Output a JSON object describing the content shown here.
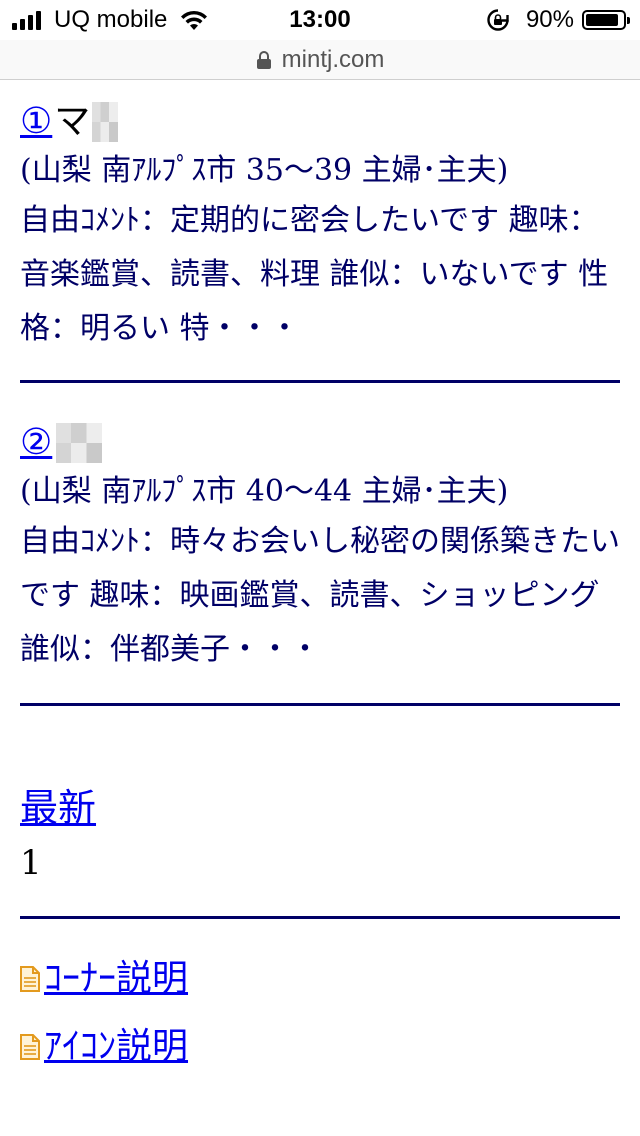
{
  "status_bar": {
    "carrier": "UQ mobile",
    "time": "13:00",
    "battery_percent": "90%",
    "battery_level": 0.9
  },
  "url_bar": {
    "domain": "mintj.com"
  },
  "posts": [
    {
      "number": "①",
      "name": "マ",
      "meta": "(山梨 南ｱﾙﾌﾟｽ市 35〜39 主婦･主夫)",
      "body": "自由ｺﾒﾝﾄ：定期的に密会したいです 趣味：音楽鑑賞、読書、料理 誰似：いないです 性格：明るい 特・・・"
    },
    {
      "number": "②",
      "name": "",
      "meta": "(山梨 南ｱﾙﾌﾟｽ市 40〜44 主婦･主夫)",
      "body": "自由ｺﾒﾝﾄ：時々お会いし秘密の関係築きたいです 趣味：映画鑑賞、読書、ショッピング 誰似：伴都美子・・・"
    }
  ],
  "pager": {
    "latest_label": "最新",
    "current_page": "1"
  },
  "footer_links": [
    {
      "label": "ｺｰﾅｰ説明",
      "icon": "document-icon"
    },
    {
      "label": "ｱｲｺﾝ説明",
      "icon": "document-icon"
    }
  ]
}
